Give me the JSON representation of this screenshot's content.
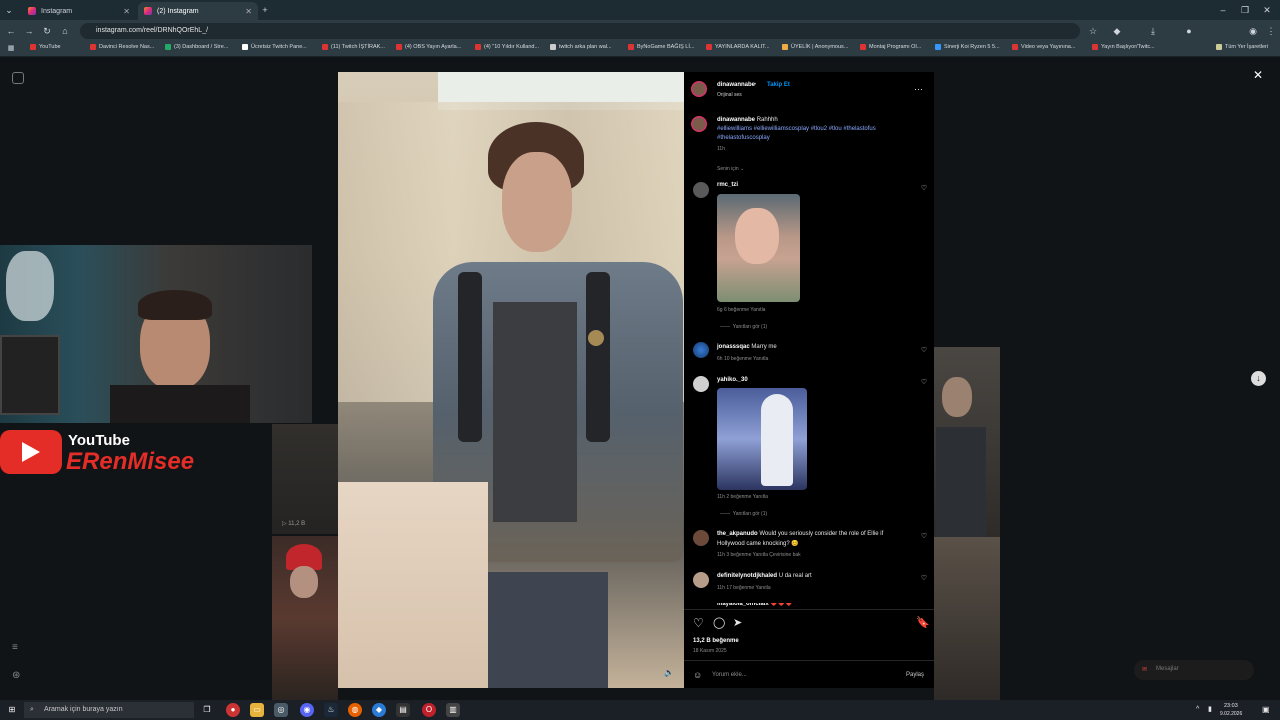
{
  "tabs": [
    {
      "label": "Instagram"
    },
    {
      "label": "(2) Instagram"
    }
  ],
  "address": {
    "url": "instagram.com/reel/DRNhQOrEhL_/"
  },
  "bookmarks": [
    "YouTube",
    "Davinci Resolve Nas...",
    "(3) Dashboard / Stre...",
    "Ücretsiz Twitch Pane...",
    "(11) Twitch İŞTİRAK...",
    "(4) OBS Yayın Ayarla...",
    "(4) \"10 Yıldır Kulland...",
    "twitch arka plan wal...",
    "ByNoGame BAĞIŞ Lİ...",
    "YAYINLARDA KALIT...",
    "ÜYELİK | Anonymous...",
    "Montaj Programı Ol...",
    "Sinerji Koi Ryzen 5 5...",
    "Video veya Yayınına...",
    "Yayın Başlıyor/Twitc...",
    "Tüm Yer İşaretleri"
  ],
  "webcam": {
    "brand": "YouTube",
    "channel": "ERenMisee"
  },
  "background": {
    "left_counter": "11,2 B"
  },
  "post": {
    "author": "dinawannabe",
    "follow": "Takip Et",
    "audio": "Orijinal ses",
    "caption_user": "dinawannabe",
    "caption_text": "Rahhhh",
    "hashtags_line1": "#elliewilliams #elliewilliamscosplay #tlou2 #tlou #thelastofus",
    "hashtags_line2": "#thelastofuscosplay",
    "caption_time": "11h",
    "sort": "Senin için"
  },
  "comments": [
    {
      "user": "rmc_tzi",
      "text": "",
      "meta": "6g   6 beğenme   Yanıtla",
      "replies": "Yanıtları gör (1)"
    },
    {
      "user": "jonasssqac",
      "text": "Marry me",
      "meta": "6h   10 beğenme   Yanıtla"
    },
    {
      "user": "yahiko._30",
      "text": "",
      "meta": "11h   2 beğenme   Yanıtla",
      "replies": "Yanıtları gör (1)"
    },
    {
      "user": "the_akpanudo",
      "text": "Would you seriously consider the role of Ellie if",
      "text2": "Hollywood came knocking? 😊",
      "meta": "11h   3 beğenme   Yanıtla   Çevirisine bak"
    },
    {
      "user": "definitelynotdjkhaled",
      "text": "U da real art",
      "meta": "11h   17 beğenme   Yanıtla"
    },
    {
      "user": "mayalola_officialx",
      "text": "❤️❤️❤️",
      "meta": ""
    }
  ],
  "footer": {
    "likes": "13,2 B beğenme",
    "date": "18 Kasım 2025",
    "comment_placeholder": "Yorum ekle...",
    "share": "Paylaş"
  },
  "messages": "Mesajlar",
  "taskbar": {
    "search_placeholder": "Aramak için buraya yazın",
    "time": "23:03",
    "date": "9.02.2026"
  },
  "colors": {
    "instagram_blue": "#0095f6",
    "tag_blue": "#8aa9ff",
    "youtube_red": "#e52d27"
  }
}
